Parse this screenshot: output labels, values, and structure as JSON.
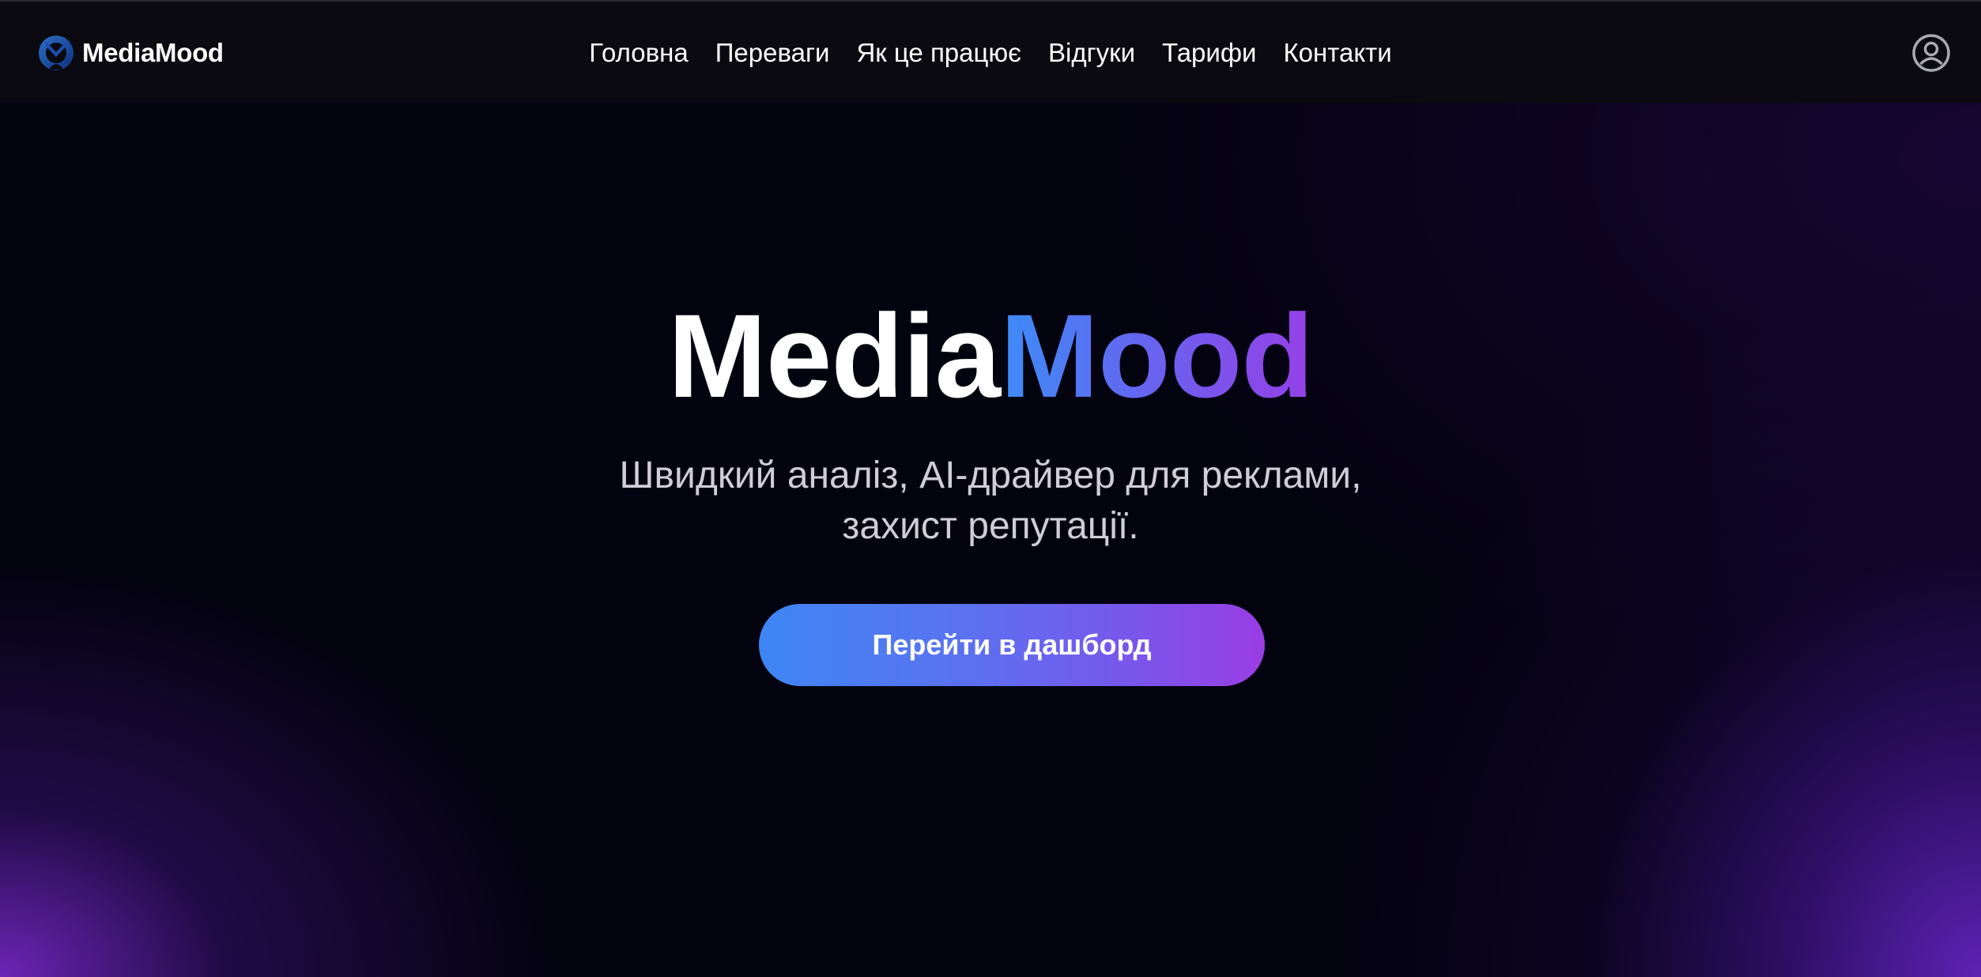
{
  "header": {
    "brand_name": "MediaMood",
    "nav": [
      {
        "label": "Головна"
      },
      {
        "label": "Переваги"
      },
      {
        "label": "Як це працює"
      },
      {
        "label": "Відгуки"
      },
      {
        "label": "Тарифи"
      },
      {
        "label": "Контакти"
      }
    ],
    "account_icon": "user-circle-icon",
    "logo_icon": "mediamood-logo-icon"
  },
  "hero": {
    "title_part1": "Media",
    "title_part2": "Mood",
    "subtitle_line1": "Швидкий аналіз, AI-драйвер для реклами,",
    "subtitle_line2": "захист репутації.",
    "cta_label": "Перейти в дашборд"
  },
  "colors": {
    "background": "#03020f",
    "header_background": "#0a0a10",
    "accent_blue": "#3d8cf6",
    "accent_purple": "#9640e6"
  }
}
